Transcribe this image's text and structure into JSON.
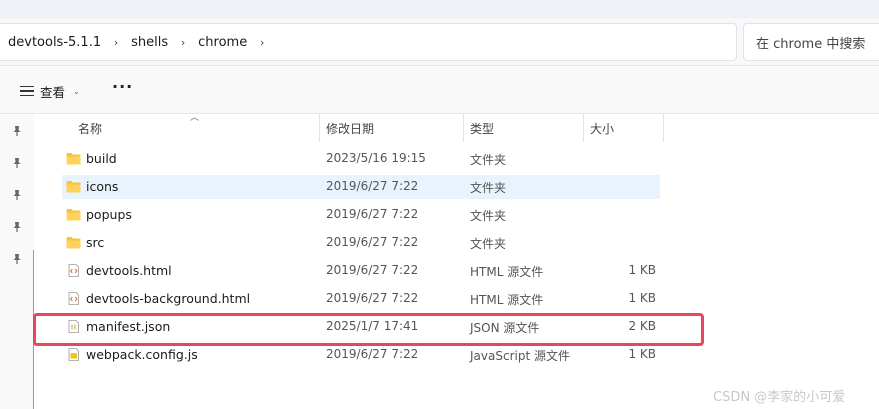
{
  "address_bar": {
    "crumbs": [
      "devtools-5.1.1",
      "shells",
      "chrome"
    ],
    "separator": "›"
  },
  "search": {
    "placeholder": "在 chrome 中搜索"
  },
  "toolbar": {
    "view_label": "查看",
    "more_label": "···"
  },
  "columns": {
    "name": "名称",
    "date": "修改日期",
    "type": "类型",
    "size": "大小"
  },
  "files": [
    {
      "name": "build",
      "date": "2023/5/16 19:15",
      "type": "文件夹",
      "size": "",
      "icon": "folder-icon"
    },
    {
      "name": "icons",
      "date": "2019/6/27 7:22",
      "type": "文件夹",
      "size": "",
      "icon": "folder-icon",
      "selected": true
    },
    {
      "name": "popups",
      "date": "2019/6/27 7:22",
      "type": "文件夹",
      "size": "",
      "icon": "folder-icon"
    },
    {
      "name": "src",
      "date": "2019/6/27 7:22",
      "type": "文件夹",
      "size": "",
      "icon": "folder-icon"
    },
    {
      "name": "devtools.html",
      "date": "2019/6/27 7:22",
      "type": "HTML 源文件",
      "size": "1 KB",
      "icon": "html-file-icon"
    },
    {
      "name": "devtools-background.html",
      "date": "2019/6/27 7:22",
      "type": "HTML 源文件",
      "size": "1 KB",
      "icon": "html-file-icon"
    },
    {
      "name": "manifest.json",
      "date": "2025/1/7 17:41",
      "type": "JSON 源文件",
      "size": "2 KB",
      "icon": "json-file-icon",
      "highlighted": true
    },
    {
      "name": "webpack.config.js",
      "date": "2019/6/27 7:22",
      "type": "JavaScript 源文件",
      "size": "1 KB",
      "icon": "js-file-icon"
    }
  ],
  "watermark": "CSDN @李家的小可爱",
  "colors": {
    "highlight": "#e8475b",
    "selected_row": "#e8f3fd",
    "folder": "#f5c342"
  }
}
